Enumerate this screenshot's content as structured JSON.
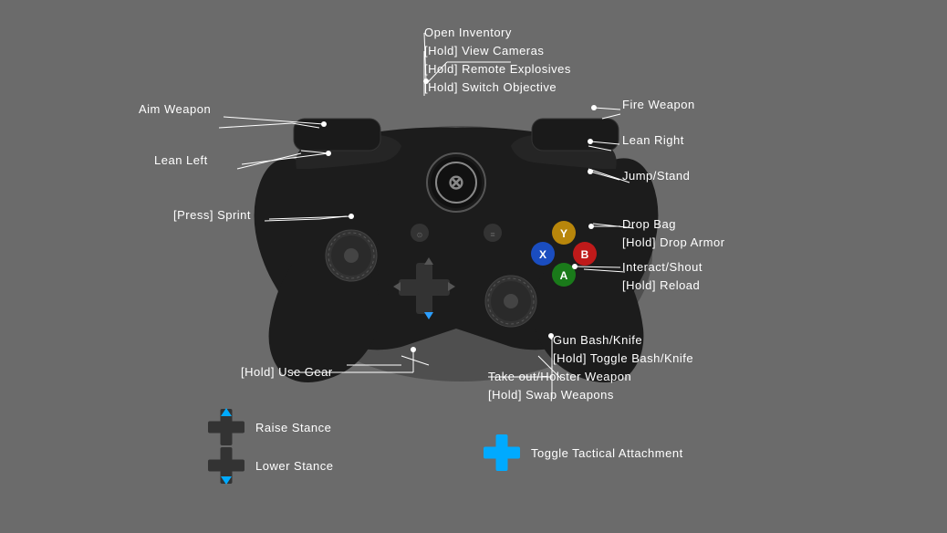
{
  "labels": {
    "open_inventory": "Open Inventory",
    "hold_view_cameras": "[Hold] View Cameras",
    "hold_remote_explosives": "[Hold] Remote Explosives",
    "hold_switch_objective": "[Hold] Switch Objective",
    "fire_weapon": "Fire Weapon",
    "lean_right": "Lean Right",
    "jump_stand": "Jump/Stand",
    "aim_weapon": "Aim Weapon",
    "lean_left": "Lean Left",
    "press_sprint": "[Press] Sprint",
    "drop_bag": "Drop Bag",
    "hold_drop_armor": "[Hold] Drop Armor",
    "interact_shout": "Interact/Shout",
    "hold_reload": "[Hold] Reload",
    "gun_bash_knife": "Gun Bash/Knife",
    "hold_toggle_bash": "[Hold] Toggle Bash/Knife",
    "take_out_holster": "Take out/Holster Weapon",
    "hold_swap_weapons": "[Hold] Swap Weapons",
    "hold_use_gear": "[Hold] Use Gear",
    "raise_stance": "Raise Stance",
    "lower_stance": "Lower Stance",
    "toggle_tactical": "Toggle Tactical Attachment"
  },
  "colors": {
    "background": "#6b6b6b",
    "controller_body": "#1a1a1a",
    "controller_shadow": "#111111",
    "white": "#ffffff",
    "cyan": "#00aaff",
    "button_y": "#d4af00",
    "button_x": "#1155cc",
    "button_b": "#cc2200",
    "button_a": "#115500",
    "xbox_ring": "#666666",
    "dpad_dark": "#333333",
    "dpad_highlight": "#00aaff"
  }
}
